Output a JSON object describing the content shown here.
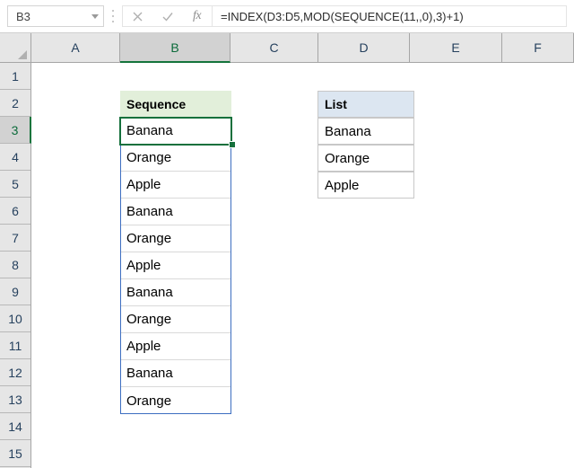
{
  "formula_bar": {
    "name_box_value": "B3",
    "cancel_icon": "close-icon",
    "confirm_icon": "check-icon",
    "function_icon": "fx-icon",
    "fx_label": "fx",
    "formula_value": "=INDEX(D3:D5,MOD(SEQUENCE(11,,0),3)+1)"
  },
  "grid": {
    "column_headers": [
      "A",
      "B",
      "C",
      "D",
      "E",
      "F"
    ],
    "selected_column": "B",
    "row_headers": [
      "1",
      "2",
      "3",
      "4",
      "5",
      "6",
      "7",
      "8",
      "9",
      "10",
      "11",
      "12",
      "13",
      "14",
      "15"
    ],
    "selected_row": "3",
    "active_cell": "B3"
  },
  "sequence_table": {
    "header": "Sequence",
    "header_bg": "#e2efda",
    "values": [
      "Banana",
      "Orange",
      "Apple",
      "Banana",
      "Orange",
      "Apple",
      "Banana",
      "Orange",
      "Apple",
      "Banana",
      "Orange"
    ]
  },
  "list_table": {
    "header": "List",
    "header_bg": "#dce6f1",
    "values": [
      "Banana",
      "Orange",
      "Apple"
    ]
  }
}
